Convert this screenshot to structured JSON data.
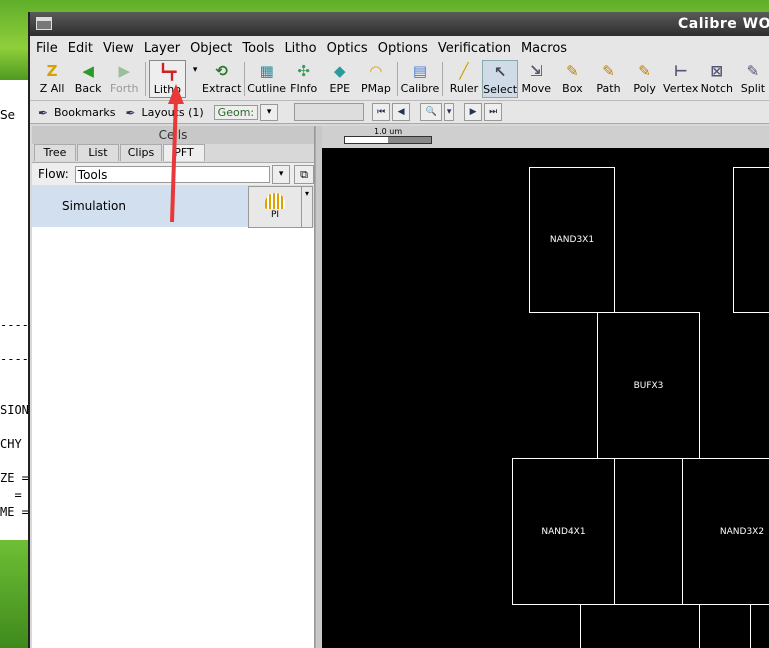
{
  "window": {
    "title": "Calibre WO"
  },
  "terminal": {
    "lines": [
      "Se",
      "----",
      "----",
      "SION",
      "CHY",
      "ZE =",
      "  =",
      "ME ="
    ]
  },
  "menu": [
    "File",
    "Edit",
    "View",
    "Layer",
    "Object",
    "Tools",
    "Litho",
    "Optics",
    "Options",
    "Verification",
    "Macros"
  ],
  "toolbar": {
    "zall": "Z All",
    "back": "Back",
    "forth": "Forth",
    "litho": "Litho",
    "extract": "Extract",
    "cutline": "Cutline",
    "finfo": "FInfo",
    "epe": "EPE",
    "pmap": "PMap",
    "calibre": "Calibre",
    "ruler": "Ruler",
    "select": "Select",
    "move": "Move",
    "box": "Box",
    "path": "Path",
    "poly": "Poly",
    "vertex": "Vertex",
    "notch": "Notch",
    "split": "Split"
  },
  "toolbar2": {
    "bookmarks": "Bookmarks",
    "layouts": "Layouts (1)",
    "geom": "Geom:"
  },
  "panel": {
    "header": "Cells",
    "tabs": [
      "Tree",
      "List",
      "Clips",
      "PFT"
    ],
    "flow_label": "Flow:",
    "flow_value": "Tools",
    "sim_label": "Simulation",
    "pi_label": "PI"
  },
  "canvas": {
    "ruler_label": "1.0 um",
    "cells": [
      "NAND3X1",
      "BUFX3",
      "NAND4X1",
      "NAND3X2"
    ]
  }
}
